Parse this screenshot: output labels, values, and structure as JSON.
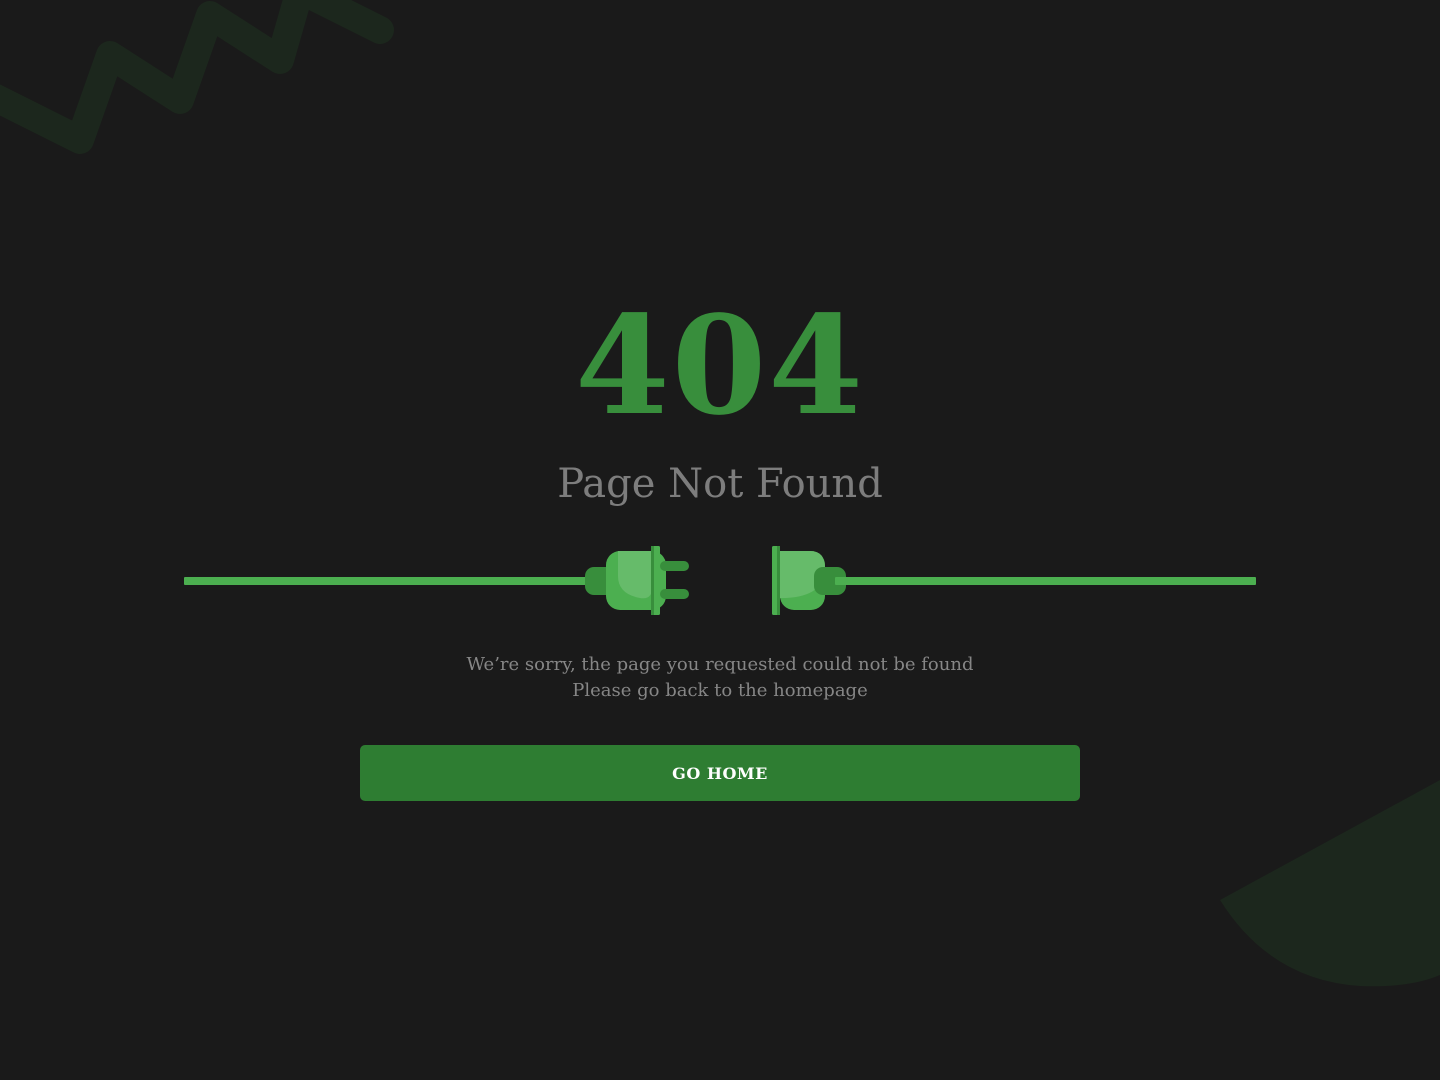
{
  "error": {
    "code": "404",
    "title": "Page Not Found"
  },
  "message": {
    "line1": "We’re sorry, the page you requested could not be found",
    "line2": "Please go back to the homepage"
  },
  "actions": {
    "home_label": "GO HOME"
  },
  "illustration": {
    "name": "unplugged-cable",
    "icons": [
      "plug-left-icon",
      "socket-right-icon"
    ]
  },
  "colors": {
    "background": "#1a1a1a",
    "accent": "#388e3c",
    "button": "#2e7d32",
    "plug_light": "#66bb6a",
    "plug_mid": "#4caf50",
    "plug_dark": "#388e3c",
    "text_muted": "#7d7d7d",
    "decoration": "#1c271d"
  }
}
